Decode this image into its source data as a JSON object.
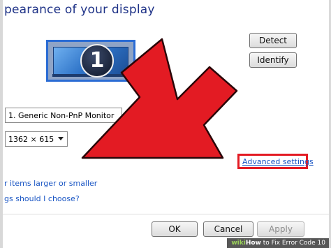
{
  "header": {
    "title": "pearance of your display"
  },
  "buttons": {
    "detect": "Detect",
    "identify": "Identify",
    "ok": "OK",
    "cancel": "Cancel",
    "apply": "Apply"
  },
  "monitor": {
    "number": "1"
  },
  "display_dropdown": {
    "value": "1. Generic Non-PnP Monitor"
  },
  "resolution_dropdown": {
    "value": "1362 × 615"
  },
  "links": {
    "advanced_settings": "Advanced settings",
    "make_larger": "r items larger or smaller",
    "which_settings": "gs should I choose?"
  },
  "watermark": {
    "brand": "wiki",
    "how": "How",
    "text": " to Fix Error Code 10"
  },
  "colors": {
    "arrow": "#e31b23",
    "highlight_box": "#e31b23",
    "link": "#1a56c4",
    "heading": "#1e3287"
  },
  "icons": {
    "pointer_arrow": "red-arrow-icon"
  }
}
